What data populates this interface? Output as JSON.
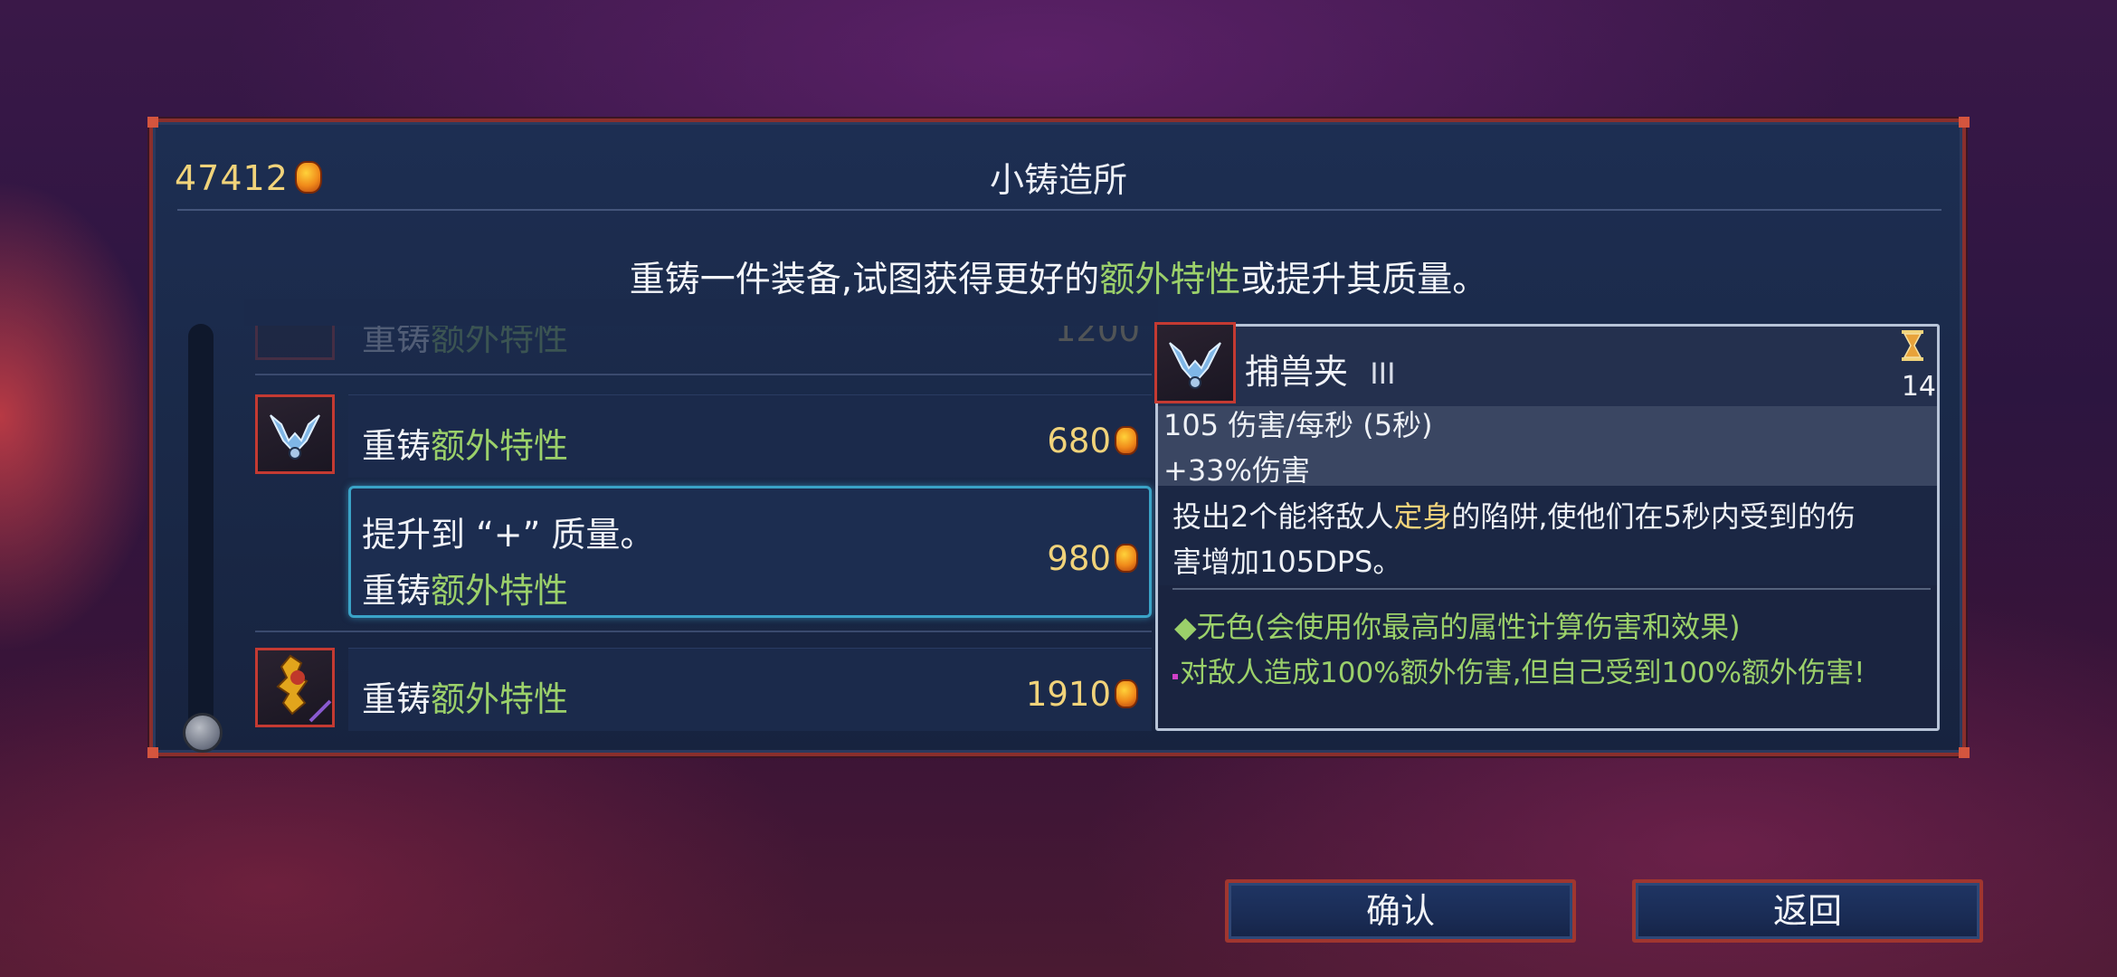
{
  "header": {
    "gold_amount": "47412",
    "title": "小铸造所"
  },
  "description": {
    "part1": "重铸一件装备,试图获得更好的",
    "highlight": "额外特性",
    "part2": "或提升其质量。"
  },
  "list": {
    "row0": {
      "prefix": "重铸",
      "highlight": "额外特性",
      "price": "1200"
    },
    "row1": {
      "prefix": "重铸",
      "highlight": "额外特性",
      "price": "680"
    },
    "row2": {
      "line1": "提升到 “+” 质量。",
      "prefix": "重铸",
      "highlight": "额外特性",
      "price": "980"
    },
    "row3": {
      "prefix": "重铸",
      "highlight": "额外特性",
      "price": "1910"
    }
  },
  "tooltip": {
    "name": "捕兽夹",
    "level": "III",
    "cooldown": "14",
    "stat_damage": "105 伤害/每秒 (5秒)",
    "stat_bonus": "+33%伤害",
    "desc_part1": "投出2个能将敌人",
    "desc_highlight": "定身",
    "desc_part2": "的陷阱,使他们在5秒内受到的伤",
    "desc_line2": "害增加105DPS。",
    "affix_color": "◆无色(会使用你最高的属性计算伤害和效果)",
    "affix_curse": "对敌人造成100%额外伤害,但自己受到100%额外伤害!"
  },
  "buttons": {
    "confirm": "确认",
    "back": "返回"
  },
  "icons": {
    "currency": "gold-cell-icon",
    "trap_item": "wolf-trap-icon",
    "golden_item": "golden-weapon-icon",
    "cooldown": "hourglass-icon"
  },
  "colors": {
    "accent_green": "#9bd06a",
    "gold": "#f1d37a",
    "border_red": "#c43a32",
    "selection_cyan": "#3aa3c7"
  }
}
